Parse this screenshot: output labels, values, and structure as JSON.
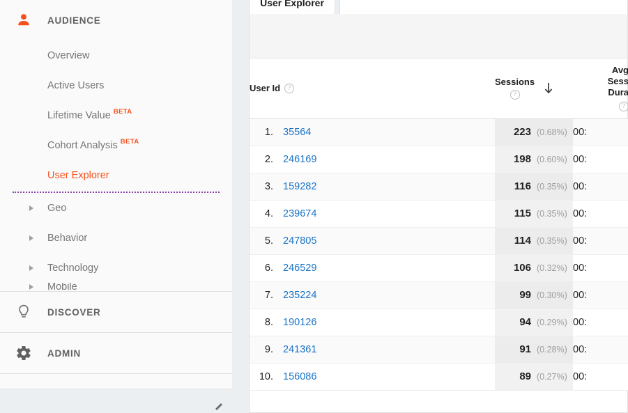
{
  "sidebar": {
    "sections": [
      {
        "id": "audience",
        "label": "AUDIENCE",
        "icon": "person-icon",
        "items": [
          {
            "label": "Overview",
            "beta": "",
            "selected": false,
            "group": false
          },
          {
            "label": "Active Users",
            "beta": "",
            "selected": false,
            "group": false
          },
          {
            "label": "Lifetime Value",
            "beta": "BETA",
            "selected": false,
            "group": false
          },
          {
            "label": "Cohort Analysis",
            "beta": "BETA",
            "selected": false,
            "group": false
          },
          {
            "label": "User Explorer",
            "beta": "",
            "selected": true,
            "group": false
          },
          {
            "label": "Geo",
            "beta": "",
            "selected": false,
            "group": true
          },
          {
            "label": "Behavior",
            "beta": "",
            "selected": false,
            "group": true
          },
          {
            "label": "Technology",
            "beta": "",
            "selected": false,
            "group": true
          },
          {
            "label": "Mobile",
            "beta": "",
            "selected": false,
            "group": true
          }
        ]
      },
      {
        "id": "discover",
        "label": "DISCOVER",
        "icon": "lightbulb-icon",
        "items": []
      },
      {
        "id": "admin",
        "label": "ADMIN",
        "icon": "gear-icon",
        "items": []
      }
    ],
    "collapse_icon": "collapse-arrow-icon"
  },
  "content": {
    "tabs": [
      {
        "id": "user-explorer",
        "label": "User Explorer",
        "active": true
      },
      {
        "id": "empty-tab",
        "label": "",
        "active": false
      }
    ],
    "table": {
      "columns": [
        {
          "key": "userid",
          "label": "User Id",
          "help": "?",
          "sorted": false
        },
        {
          "key": "sessions",
          "label": "Sessions",
          "help": "?",
          "sorted": true,
          "sort_dir": "desc",
          "sort_glyph": "↓"
        },
        {
          "key": "avgdur",
          "label_lines": [
            "Avg",
            "Sess",
            "Dura"
          ],
          "help": "?",
          "sorted": false
        }
      ],
      "rows": [
        {
          "rank": "1.",
          "user_id": "35564",
          "sessions": "223",
          "sessions_pct": "(0.68%)",
          "avg_duration": "00:"
        },
        {
          "rank": "2.",
          "user_id": "246169",
          "sessions": "198",
          "sessions_pct": "(0.60%)",
          "avg_duration": "00:"
        },
        {
          "rank": "3.",
          "user_id": "159282",
          "sessions": "116",
          "sessions_pct": "(0.35%)",
          "avg_duration": "00:"
        },
        {
          "rank": "4.",
          "user_id": "239674",
          "sessions": "115",
          "sessions_pct": "(0.35%)",
          "avg_duration": "00:"
        },
        {
          "rank": "5.",
          "user_id": "247805",
          "sessions": "114",
          "sessions_pct": "(0.35%)",
          "avg_duration": "00:"
        },
        {
          "rank": "6.",
          "user_id": "246529",
          "sessions": "106",
          "sessions_pct": "(0.32%)",
          "avg_duration": "00:"
        },
        {
          "rank": "7.",
          "user_id": "235224",
          "sessions": "99",
          "sessions_pct": "(0.30%)",
          "avg_duration": "00:"
        },
        {
          "rank": "8.",
          "user_id": "190126",
          "sessions": "94",
          "sessions_pct": "(0.29%)",
          "avg_duration": "00:"
        },
        {
          "rank": "9.",
          "user_id": "241361",
          "sessions": "91",
          "sessions_pct": "(0.28%)",
          "avg_duration": "00:"
        },
        {
          "rank": "10.",
          "user_id": "156086",
          "sessions": "89",
          "sessions_pct": "(0.27%)",
          "avg_duration": "00:"
        }
      ]
    }
  },
  "colors": {
    "accent_orange": "#f4511e",
    "link_blue": "#1a73c8",
    "divider_purple": "#7b1fa2",
    "text_primary": "#212121",
    "text_secondary": "#757575"
  }
}
